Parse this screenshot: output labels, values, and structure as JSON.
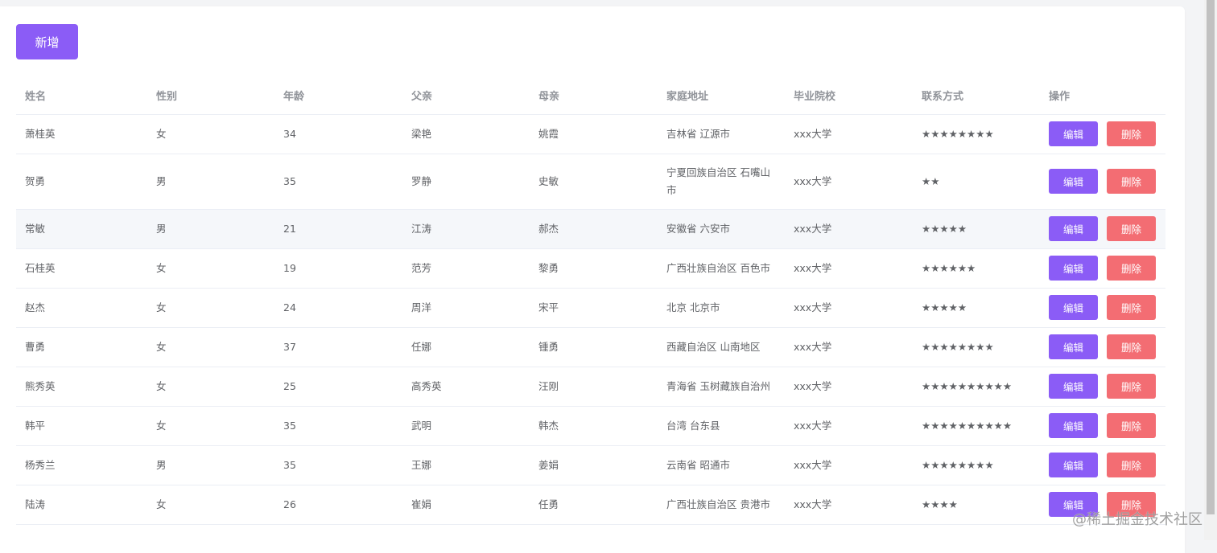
{
  "toolbar": {
    "add_label": "新增"
  },
  "columns": [
    "姓名",
    "性别",
    "年龄",
    "父亲",
    "母亲",
    "家庭地址",
    "毕业院校",
    "联系方式",
    "操作"
  ],
  "row_actions": {
    "edit_label": "编辑",
    "delete_label": "删除"
  },
  "rows": [
    {
      "name": "萧桂英",
      "gender": "女",
      "age": "34",
      "father": "梁艳",
      "mother": "姚霞",
      "address": "吉林省 辽源市",
      "school": "xxx大学",
      "contact": "★★★★★★★★"
    },
    {
      "name": "贺勇",
      "gender": "男",
      "age": "35",
      "father": "罗静",
      "mother": "史敏",
      "address": "宁夏回族自治区 石嘴山市",
      "school": "xxx大学",
      "contact": "★★"
    },
    {
      "name": "常敏",
      "gender": "男",
      "age": "21",
      "father": "江涛",
      "mother": "郝杰",
      "address": "安徽省 六安市",
      "school": "xxx大学",
      "contact": "★★★★★"
    },
    {
      "name": "石桂英",
      "gender": "女",
      "age": "19",
      "father": "范芳",
      "mother": "黎勇",
      "address": "广西壮族自治区 百色市",
      "school": "xxx大学",
      "contact": "★★★★★★"
    },
    {
      "name": "赵杰",
      "gender": "女",
      "age": "24",
      "father": "周洋",
      "mother": "宋平",
      "address": "北京 北京市",
      "school": "xxx大学",
      "contact": "★★★★★"
    },
    {
      "name": "曹勇",
      "gender": "女",
      "age": "37",
      "father": "任娜",
      "mother": "锺勇",
      "address": "西藏自治区 山南地区",
      "school": "xxx大学",
      "contact": "★★★★★★★★"
    },
    {
      "name": "熊秀英",
      "gender": "女",
      "age": "25",
      "father": "高秀英",
      "mother": "汪刚",
      "address": "青海省 玉树藏族自治州",
      "school": "xxx大学",
      "contact": "★★★★★★★★★★"
    },
    {
      "name": "韩平",
      "gender": "女",
      "age": "35",
      "father": "武明",
      "mother": "韩杰",
      "address": "台湾 台东县",
      "school": "xxx大学",
      "contact": "★★★★★★★★★★"
    },
    {
      "name": "杨秀兰",
      "gender": "男",
      "age": "35",
      "father": "王娜",
      "mother": "姜娟",
      "address": "云南省 昭通市",
      "school": "xxx大学",
      "contact": "★★★★★★★★"
    },
    {
      "name": "陆涛",
      "gender": "女",
      "age": "26",
      "father": "崔娟",
      "mother": "任勇",
      "address": "广西壮族自治区 贵港市",
      "school": "xxx大学",
      "contact": "★★★★"
    }
  ],
  "watermark": "@稀土掘金技术社区",
  "colors": {
    "primary": "#8b5cf6",
    "danger": "#f36d73",
    "text": "#606266",
    "header_text": "#909399",
    "border": "#ebeef5",
    "hover_bg": "#f5f7fa"
  }
}
